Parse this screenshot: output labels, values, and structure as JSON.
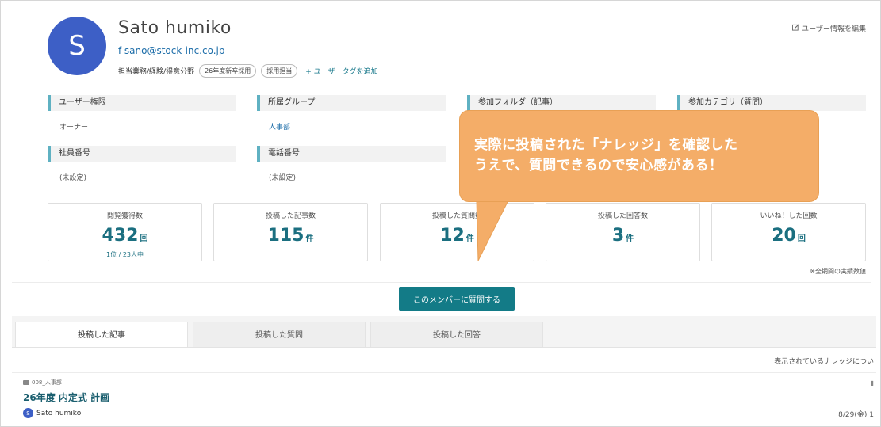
{
  "user": {
    "initial": "S",
    "name": "Sato humiko",
    "email": "f-sano@stock-inc.co.jp",
    "department_line": "担当業務/経験/得意分野",
    "tags": [
      "26年度新卒採用",
      "採用担当"
    ],
    "add_tag_label": "+ ユーザータグを追加",
    "edit_label": "ユーザー情報を編集"
  },
  "info": {
    "role_label": "ユーザー権限",
    "role_value": "オーナー",
    "group_label": "所属グループ",
    "group_value": "人事部",
    "folder_label": "参加フォルダ（記事）",
    "category_label": "参加カテゴリ（質問）",
    "employee_no_label": "社員番号",
    "employee_no_value": "(未設定)",
    "phone_label": "電話番号",
    "phone_value": "(未設定)"
  },
  "stats": [
    {
      "label": "閲覧獲得数",
      "value": "432",
      "unit": "回",
      "sub": "1位 / 23人中"
    },
    {
      "label": "投稿した記事数",
      "value": "115",
      "unit": "件"
    },
    {
      "label": "投稿した質問数",
      "value": "12",
      "unit": "件"
    },
    {
      "label": "投稿した回答数",
      "value": "3",
      "unit": "件"
    },
    {
      "label": "いいね！した回数",
      "value": "20",
      "unit": "回"
    }
  ],
  "stats_note": "※全期間の実績数値",
  "ask_button": "このメンバーに質問する",
  "tabs": [
    "投稿した記事",
    "投稿した質問",
    "投稿した回答"
  ],
  "list_caption": "表示されているナレッジについ",
  "article": {
    "folder": "008_人事部",
    "title": "26年度 内定式 計画",
    "author_initial": "S",
    "author": "Sato humiko",
    "date": "8/29(金) 1"
  },
  "callout": {
    "line1": "実際に投稿された「ナレッジ」を確認した",
    "line2": "うえで、質問できるので安心感がある！"
  },
  "colors": {
    "accent": "#137b87",
    "avatar": "#3d5fc6",
    "callout": "#f4ad68"
  }
}
